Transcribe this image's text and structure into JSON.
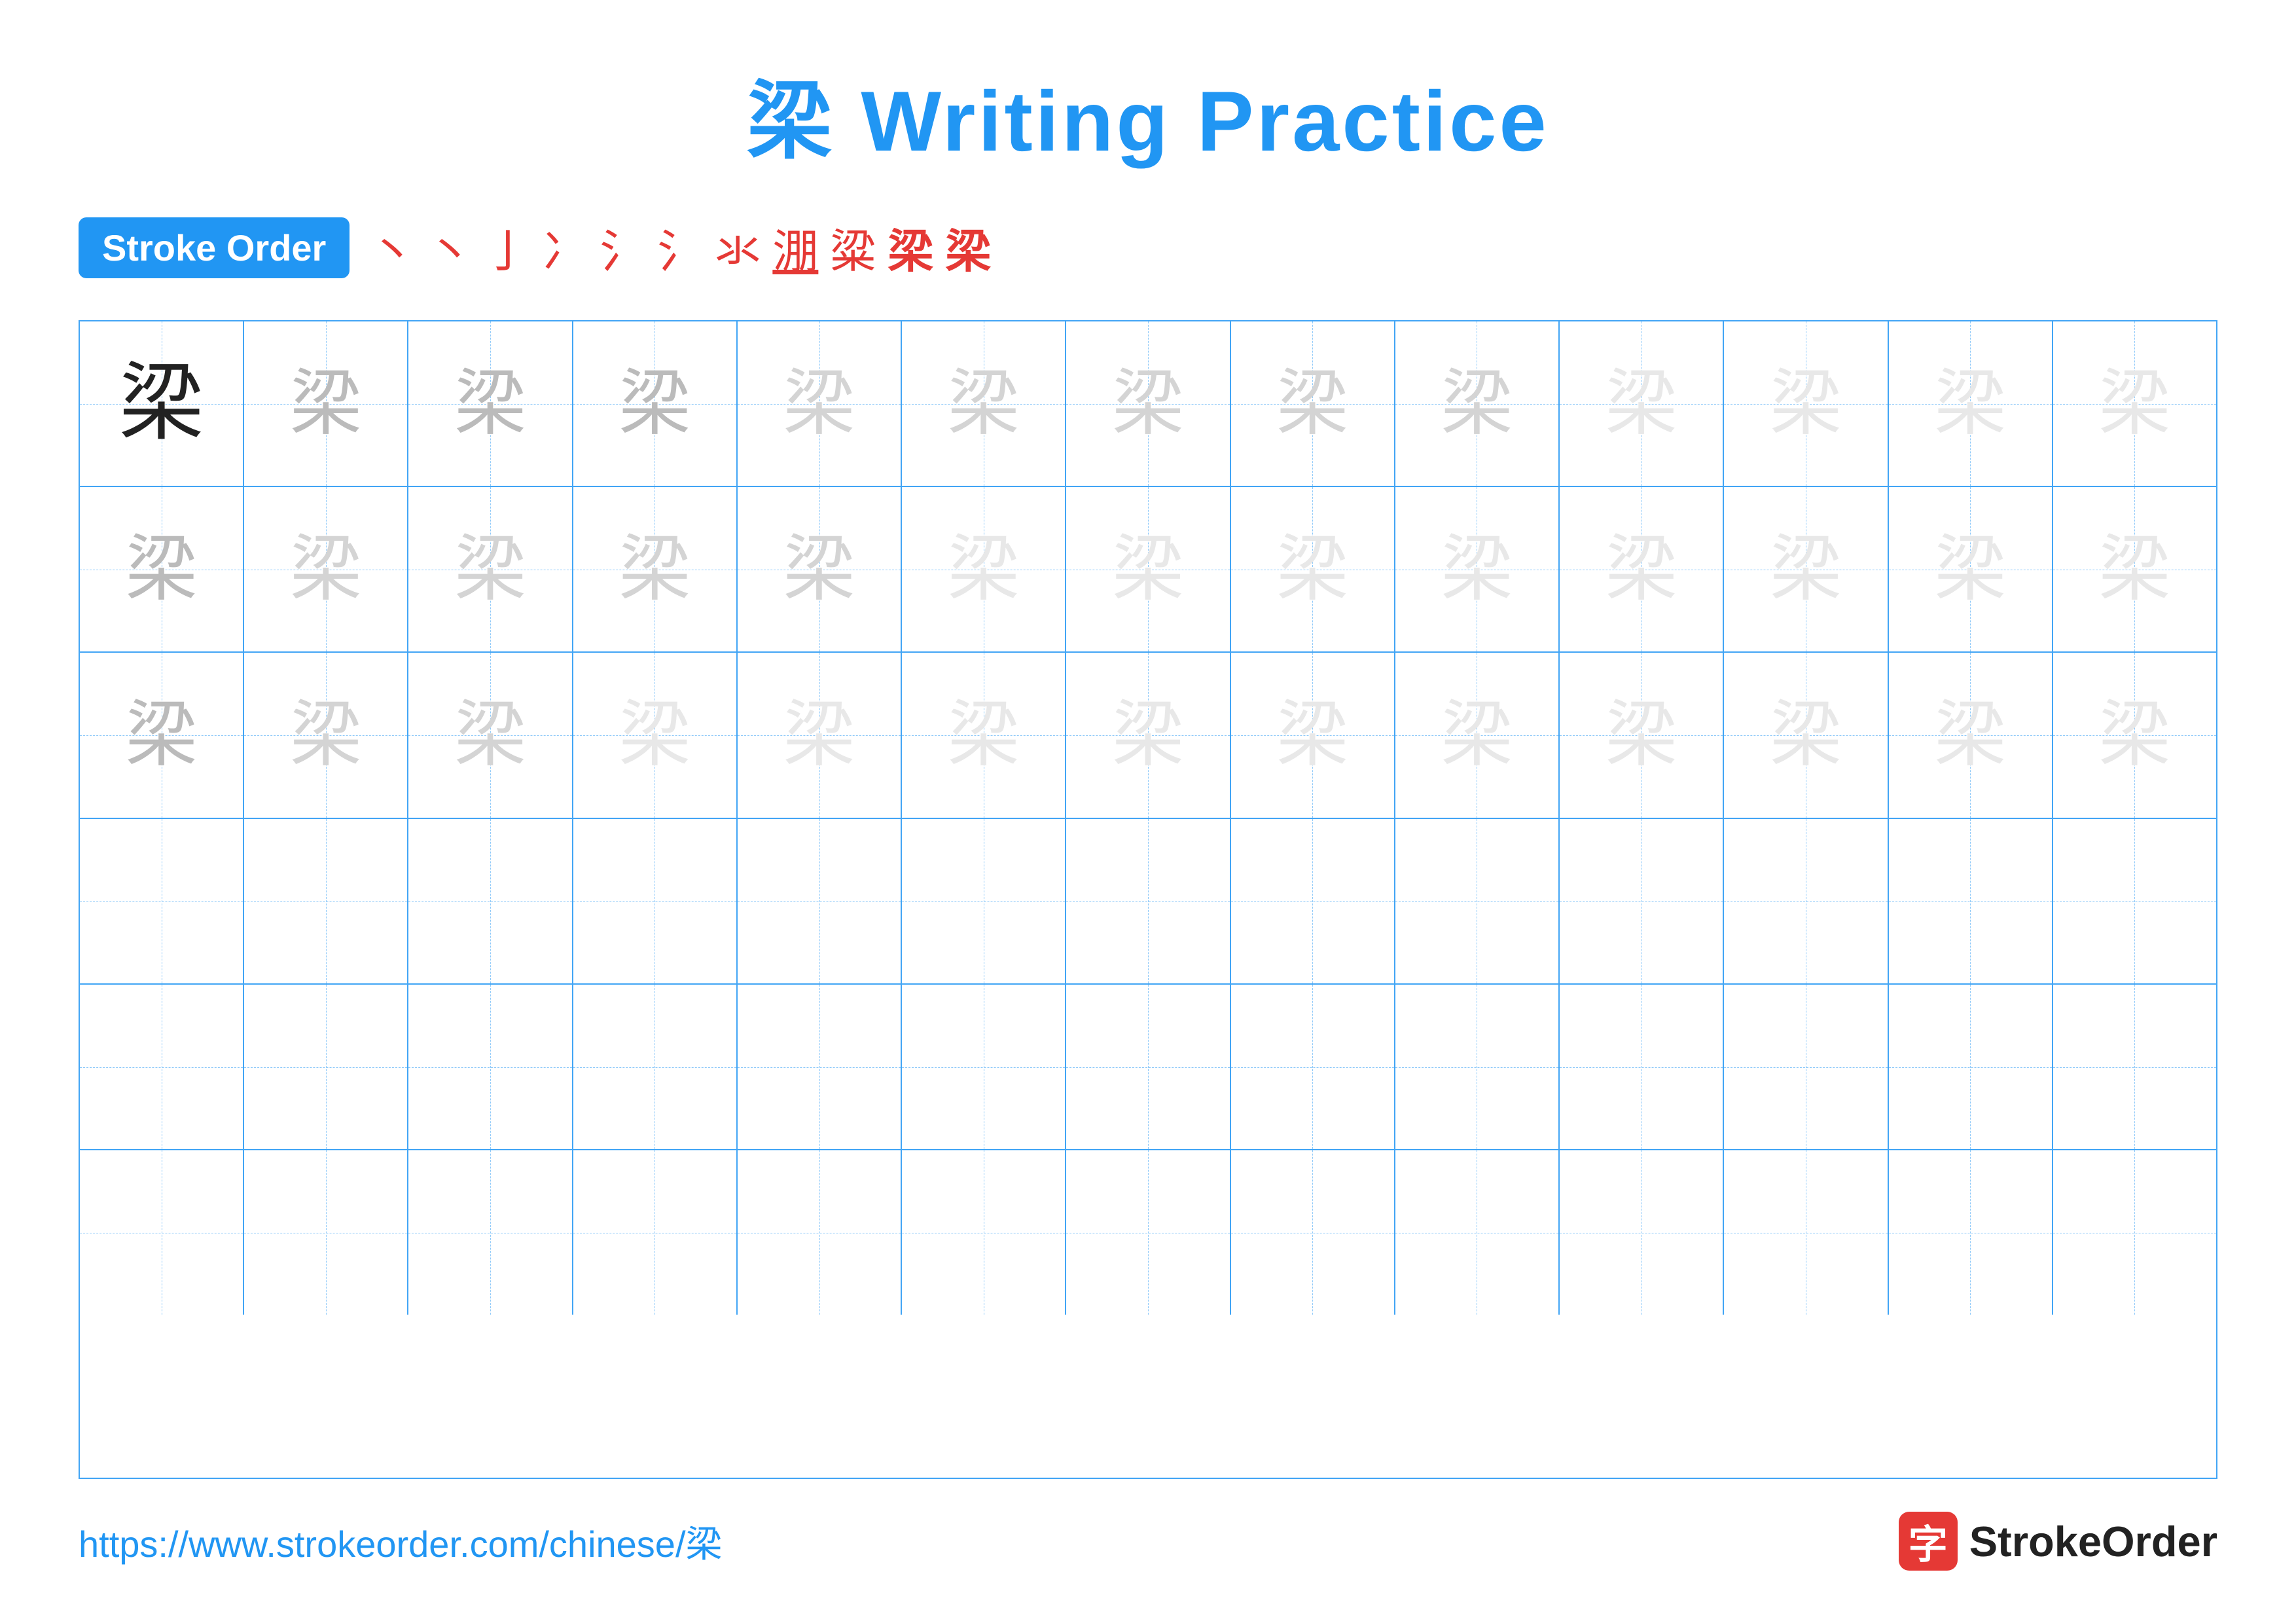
{
  "title": {
    "char": "梁",
    "text": " Writing Practice"
  },
  "stroke_order": {
    "badge_label": "Stroke Order",
    "steps": [
      "丶",
      "丶",
      "亅",
      "冫",
      "氵",
      "氵",
      "氺",
      "淜",
      "粱",
      "梁",
      "梁"
    ]
  },
  "grid": {
    "rows": 6,
    "cols": 13,
    "main_char": "梁"
  },
  "footer": {
    "link": "https://www.strokeorder.com/chinese/梁",
    "logo_icon": "字",
    "logo_text": "StrokeOrder"
  }
}
